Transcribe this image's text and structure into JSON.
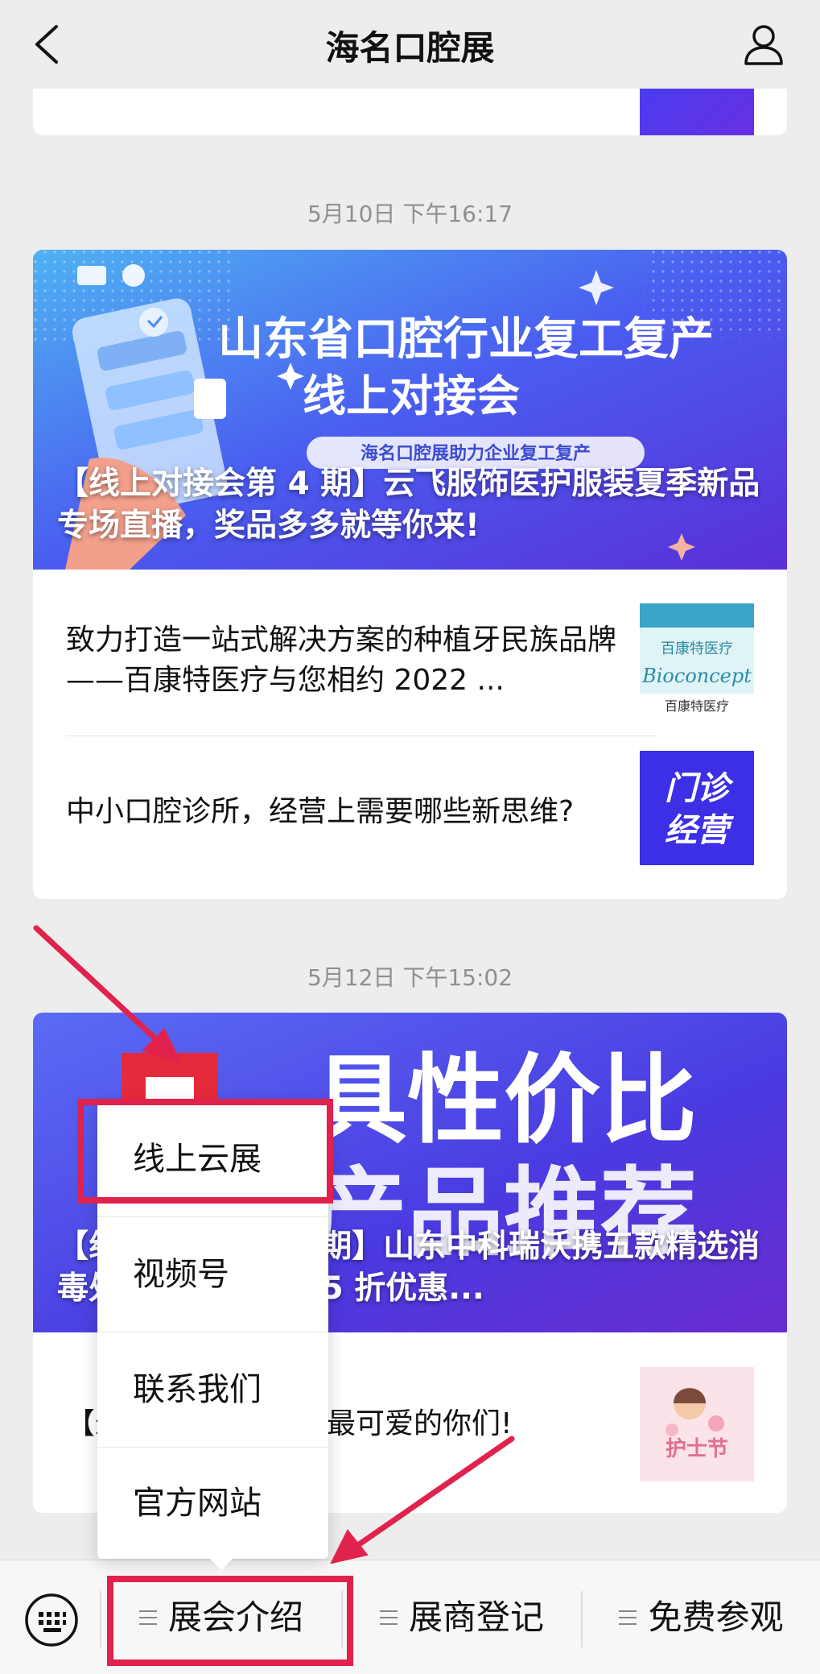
{
  "header": {
    "title": "海名口腔展"
  },
  "sections": [
    {
      "timestamp": "5月10日 下午16:17",
      "banner_text": {
        "line1": "山东省口腔行业复工复产",
        "line2": "线上对接会",
        "ribbon": "海名口腔展助力企业复工复产"
      },
      "banner_caption": "【线上对接会第 4 期】云飞服饰医护服装夏季新品专场直播，奖品多多就等你来!",
      "items": [
        {
          "title": "致力打造一站式解决方案的种植牙民族品牌——百康特医疗与您相约 2022 ...",
          "thumb_text": [
            "百康特医疗",
            "Bioconcept",
            "百康特医疗"
          ]
        },
        {
          "title": "中小口腔诊所，经营上需要哪些新思维?",
          "thumb_text": [
            "门诊",
            "经营"
          ]
        }
      ]
    },
    {
      "timestamp": "5月12日 下午15:02",
      "banner_text": {
        "line1": "具性价比",
        "line2": "产品推荐"
      },
      "banner_caption": "【线上对接会第 5 期】山东中科瑞沃携五款精选消毒处理设备限时 8.5 折优惠...",
      "items": [
        {
          "title": "【最美护士节】致敬最可爱的你们!"
        }
      ]
    }
  ],
  "popup_menu": {
    "items": [
      "线上云展",
      "视频号",
      "联系我们",
      "官方网站"
    ]
  },
  "bottom_menu": {
    "items": [
      "展会介绍",
      "展商登记",
      "免费参观"
    ]
  },
  "colors": {
    "annotation_red": "#e0224c",
    "banner_blue": "#4a50e8"
  }
}
